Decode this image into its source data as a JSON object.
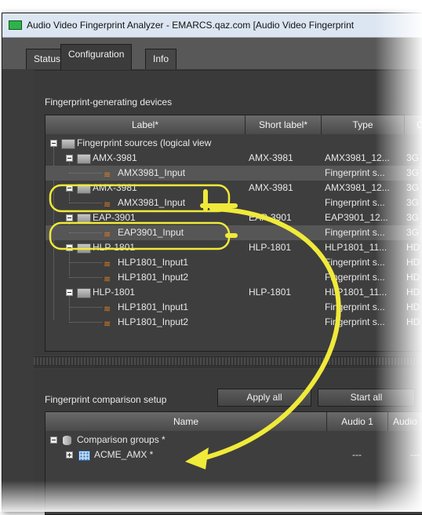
{
  "window": {
    "title": "Audio Video Fingerprint Analyzer - EMARCS.qaz.com [Audio Video Fingerprint"
  },
  "tabs": [
    {
      "label": "Status"
    },
    {
      "label": "Configuration"
    },
    {
      "label": "Info"
    }
  ],
  "devices": {
    "title": "Fingerprint-generating devices",
    "columns": [
      "Label*",
      "Short label*",
      "Type",
      "C"
    ],
    "rows": [
      {
        "label": "Fingerprint sources (logical view",
        "short": "",
        "type": "",
        "c": ""
      },
      {
        "label": "AMX-3981",
        "short": "AMX-3981",
        "type": "AMX3981_12...",
        "c": "3G"
      },
      {
        "label": "AMX3981_Input",
        "short": "",
        "type": "Fingerprint s...",
        "c": "3G"
      },
      {
        "label": "AMX-3981",
        "short": "AMX-3981",
        "type": "AMX3981_12...",
        "c": "3G"
      },
      {
        "label": "AMX3981_Input",
        "short": "",
        "type": "Fingerprint s...",
        "c": "3G"
      },
      {
        "label": "EAP-3901",
        "short": "EAP-3901",
        "type": "EAP3901_12...",
        "c": "3G"
      },
      {
        "label": "EAP3901_Input",
        "short": "",
        "type": "Fingerprint s...",
        "c": "3G"
      },
      {
        "label": "HLP-1801",
        "short": "HLP-1801",
        "type": "HLP1801_11...",
        "c": "HD"
      },
      {
        "label": "HLP1801_Input1",
        "short": "",
        "type": "Fingerprint s...",
        "c": "HD"
      },
      {
        "label": "HLP1801_Input2",
        "short": "",
        "type": "Fingerprint s...",
        "c": "HD"
      },
      {
        "label": "HLP-1801",
        "short": "HLP-1801",
        "type": "HLP1801_11...",
        "c": "HD"
      },
      {
        "label": "HLP1801_Input1",
        "short": "",
        "type": "Fingerprint s...",
        "c": "HD"
      },
      {
        "label": "HLP1801_Input2",
        "short": "",
        "type": "Fingerprint s...",
        "c": "HD"
      }
    ]
  },
  "comparison": {
    "title": "Fingerprint comparison setup",
    "apply_all": "Apply all",
    "start_all": "Start all",
    "columns": [
      "Name",
      "Audio 1",
      "Audio"
    ],
    "rows": [
      {
        "name": "Comparison groups *",
        "audio1": "",
        "audio2": ""
      },
      {
        "name": "ACME_AMX *",
        "audio1": "---",
        "audio2": "---"
      }
    ]
  },
  "colors": {
    "annotation": "#f0ea3a",
    "window_bg": "#3c3c3c",
    "accent_icon": "#2fb24a"
  }
}
